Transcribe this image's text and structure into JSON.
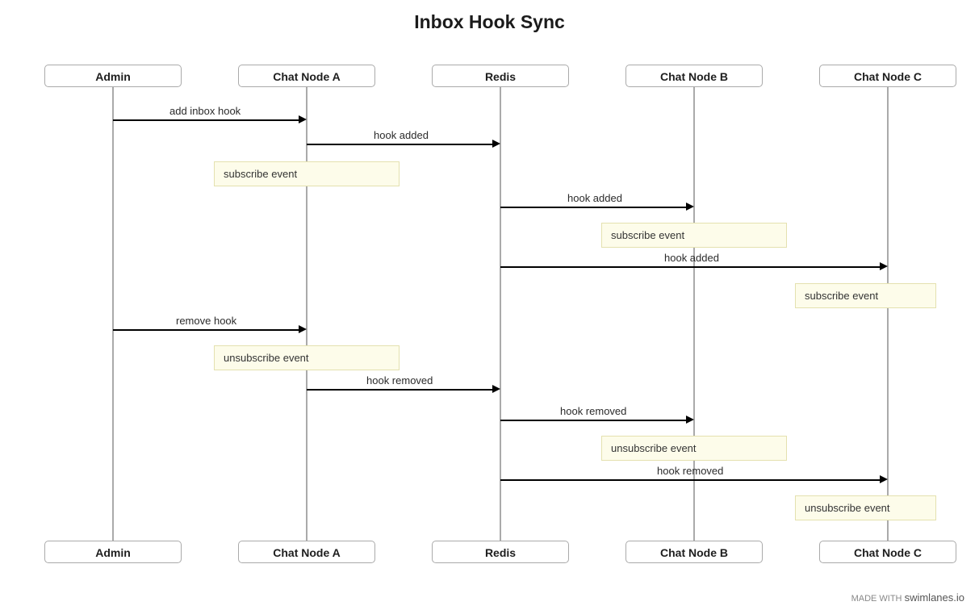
{
  "title": "Inbox Hook Sync",
  "lanes": {
    "admin": "Admin",
    "nodeA": "Chat Node A",
    "redis": "Redis",
    "nodeB": "Chat Node B",
    "nodeC": "Chat Node C"
  },
  "messages": {
    "m1": "add inbox hook",
    "m2": "hook added",
    "m3": "hook added",
    "m4": "hook added",
    "m5": "remove hook",
    "m6": "hook removed",
    "m7": "hook removed",
    "m8": "hook removed"
  },
  "notes": {
    "n1": "subscribe event",
    "n2": "subscribe event",
    "n3": "subscribe event",
    "n4": "unsubscribe event",
    "n5": "unsubscribe event",
    "n6": "unsubscribe event"
  },
  "footer": {
    "prefix": "MADE WITH",
    "brand": "swimlanes.io"
  },
  "chart_data": {
    "type": "sequence-diagram",
    "title": "Inbox Hook Sync",
    "participants": [
      "Admin",
      "Chat Node A",
      "Redis",
      "Chat Node B",
      "Chat Node C"
    ],
    "events": [
      {
        "kind": "message",
        "from": "Admin",
        "to": "Chat Node A",
        "label": "add inbox hook"
      },
      {
        "kind": "message",
        "from": "Chat Node A",
        "to": "Redis",
        "label": "hook added"
      },
      {
        "kind": "note",
        "over": "Chat Node A",
        "label": "subscribe event"
      },
      {
        "kind": "message",
        "from": "Redis",
        "to": "Chat Node B",
        "label": "hook added"
      },
      {
        "kind": "note",
        "over": "Chat Node B",
        "label": "subscribe event"
      },
      {
        "kind": "message",
        "from": "Redis",
        "to": "Chat Node C",
        "label": "hook added"
      },
      {
        "kind": "note",
        "over": "Chat Node C",
        "label": "subscribe event"
      },
      {
        "kind": "message",
        "from": "Admin",
        "to": "Chat Node A",
        "label": "remove hook"
      },
      {
        "kind": "note",
        "over": "Chat Node A",
        "label": "unsubscribe event"
      },
      {
        "kind": "message",
        "from": "Chat Node A",
        "to": "Redis",
        "label": "hook removed"
      },
      {
        "kind": "message",
        "from": "Redis",
        "to": "Chat Node B",
        "label": "hook removed"
      },
      {
        "kind": "note",
        "over": "Chat Node B",
        "label": "unsubscribe event"
      },
      {
        "kind": "message",
        "from": "Redis",
        "to": "Chat Node C",
        "label": "hook removed"
      },
      {
        "kind": "note",
        "over": "Chat Node C",
        "label": "unsubscribe event"
      }
    ]
  }
}
